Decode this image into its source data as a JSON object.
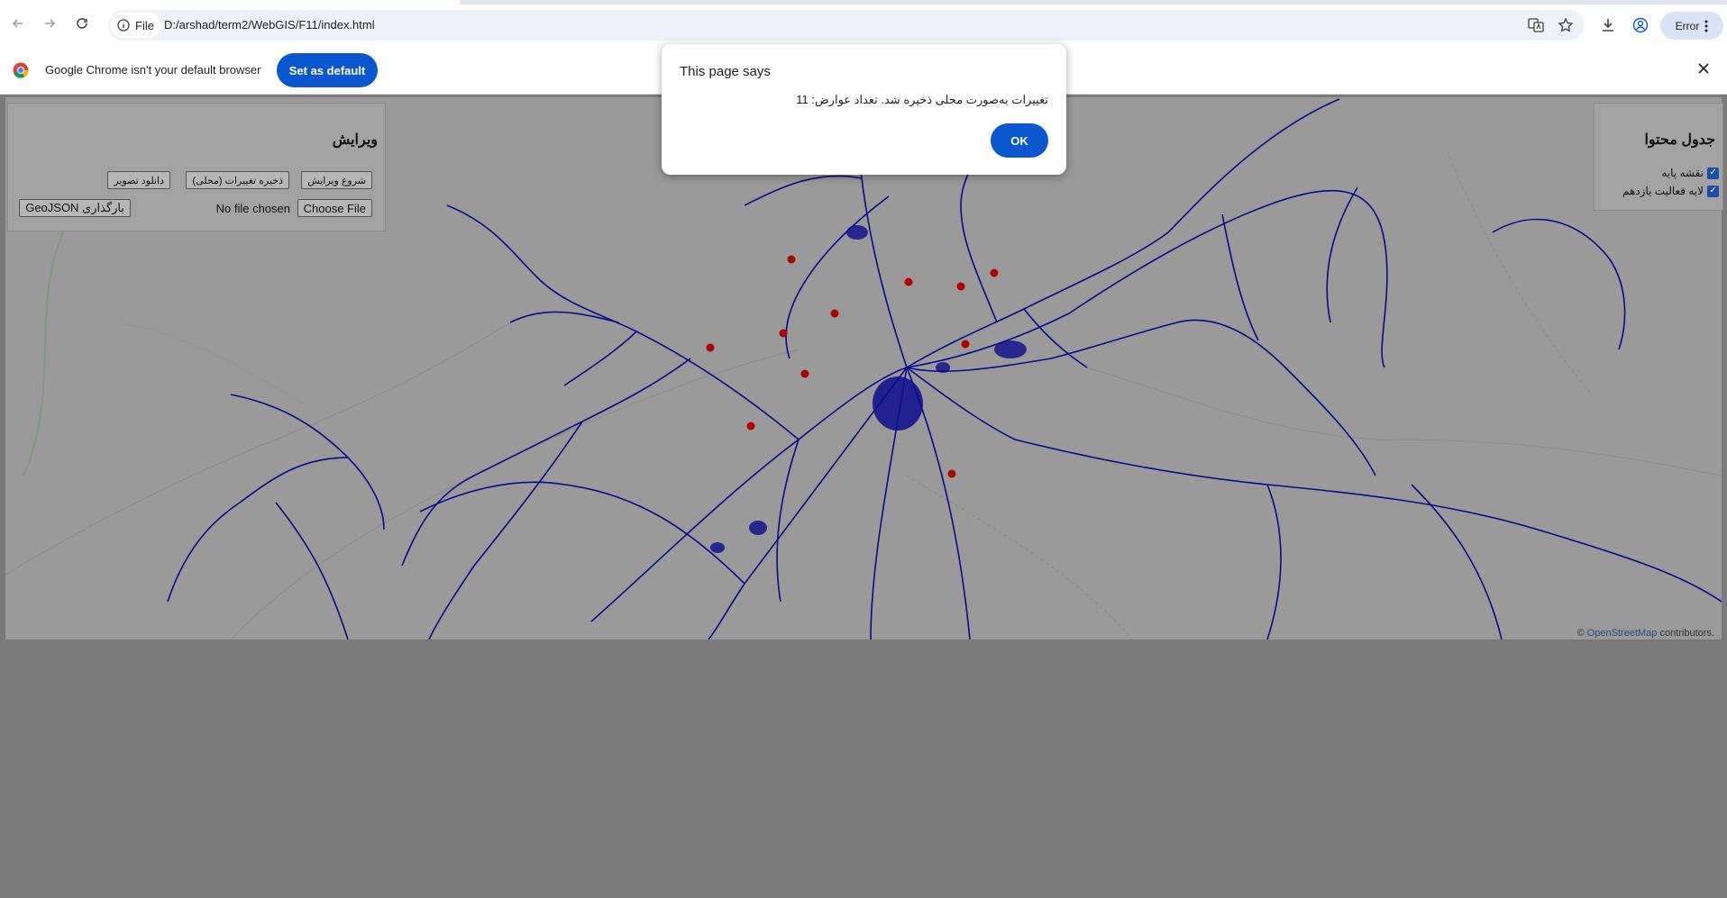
{
  "browser": {
    "site_chip": "File",
    "url": "D:/arshad/term2/WebGIS/F11/index.html",
    "profile_status": "Error"
  },
  "infobar": {
    "message": "Google Chrome isn't your default browser",
    "set_default_label": "Set as default"
  },
  "dialog": {
    "title": "This page says",
    "message": "تغییرات به‌صورت محلی ذخیره شد. تعداد عوارض: 11",
    "ok_label": "OK"
  },
  "edit_panel": {
    "title": "ویرایش",
    "start_edit_label": "شروع ویرایش",
    "save_local_label": "ذخیره تغییرات (محلی)",
    "download_image_label": "دانلود تصویر",
    "choose_file_label": "Choose File",
    "no_file_text": "No file chosen",
    "load_geojson_label": "بارگذاری GeoJSON"
  },
  "toc_panel": {
    "title": "جدول محتوا",
    "layers": [
      {
        "label": "نقشه پایه",
        "checked": true
      },
      {
        "label": "لایه فعالیت یازدهم",
        "checked": true
      }
    ]
  },
  "map": {
    "attribution_prefix": "©",
    "attribution_link": "OpenStreetMap",
    "attribution_suffix": "contributors.",
    "road_color": "#0a0a8c",
    "point_color": "#b00000"
  }
}
